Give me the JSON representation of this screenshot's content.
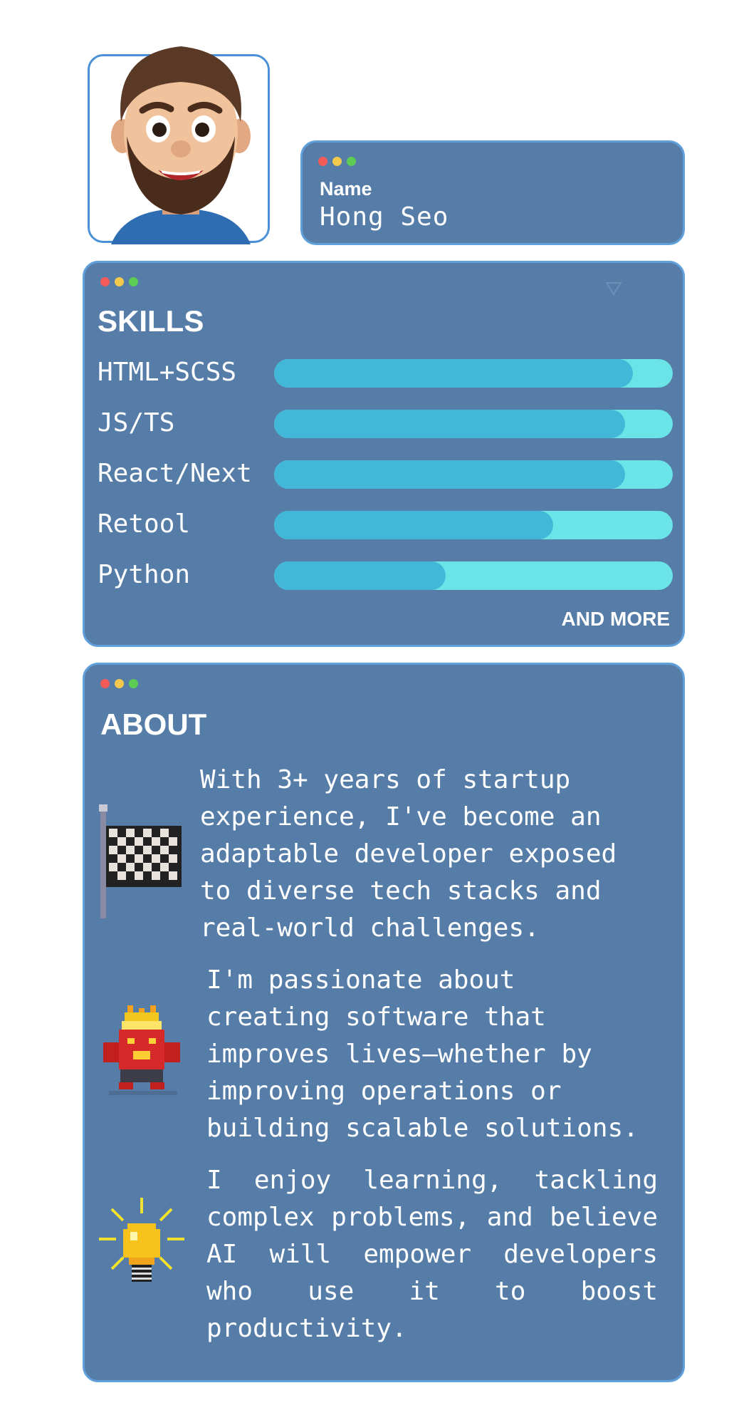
{
  "avatar": {
    "icon": "memoji-avatar-icon"
  },
  "name_card": {
    "label": "Name",
    "value": "Hong Seo"
  },
  "skills": {
    "title": "SKILLS",
    "items": [
      {
        "name": "HTML+SCSS",
        "level": 0.9
      },
      {
        "name": "JS/TS",
        "level": 0.88
      },
      {
        "name": "React/Next",
        "level": 0.88
      },
      {
        "name": "Retool",
        "level": 0.7
      },
      {
        "name": "Python",
        "level": 0.43
      }
    ],
    "more_label": "AND MORE"
  },
  "about": {
    "title": "ABOUT",
    "paragraphs": [
      "With 3+ years of startup\nexperience, I've become an\nadaptable developer exposed\nto diverse tech stacks and\nreal-world challenges.",
      "I'm passionate about\ncreating software that\nimproves lives—whether by\nimproving operations or\nbuilding scalable solutions.",
      "I enjoy learning, tackling complex problems, and believe AI will empower developers who use it to boost productivity."
    ],
    "icons": [
      "checkered-flag-icon",
      "fire-monster-icon",
      "lightbulb-icon"
    ]
  },
  "colors": {
    "card_bg": "#567da8",
    "card_border": "#5f9fda",
    "bar_fill": "#42b7d8",
    "bar_track": "#6ae4e6",
    "dot_red": "#f25b57",
    "dot_yellow": "#f2c94c",
    "dot_green": "#5ccc52"
  }
}
